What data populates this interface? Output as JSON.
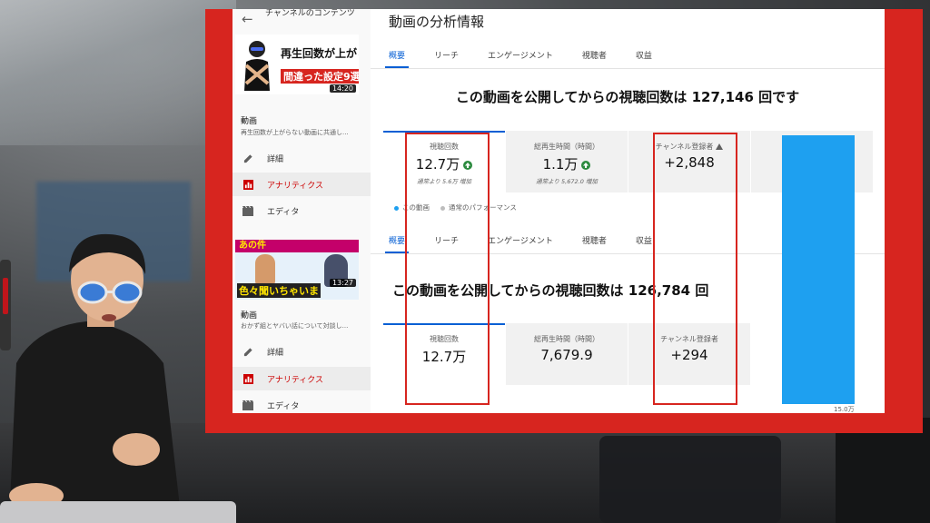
{
  "top": {
    "sidebar": {
      "channel_title": "チャンネルのコンテンツ",
      "thumb_line1": "再生回数が上がらない",
      "thumb_line2": "間違った設定9選",
      "duration": "14:20",
      "video_label": "動画",
      "video_desc": "再生回数が上がらない動画に共通し...",
      "items": [
        {
          "icon": "pencil-icon",
          "label": "詳細"
        },
        {
          "icon": "analytics-icon",
          "label": "アナリティクス"
        },
        {
          "icon": "film-icon",
          "label": "エディタ"
        }
      ]
    },
    "page_title": "動画の分析情報",
    "tabs": [
      "概要",
      "リーチ",
      "エンゲージメント",
      "視聴者",
      "収益"
    ],
    "headline": "この動画を公開してからの視聴回数は 127,146 回です",
    "cards": [
      {
        "label": "視聴回数",
        "value": "12.7万",
        "sub": "通常より 5.6万 増加",
        "trend": "up"
      },
      {
        "label": "総再生時間（時間）",
        "value": "1.1万",
        "sub": "通常より 5,672.0 増加",
        "trend": "up"
      },
      {
        "label": "チャンネル登録者",
        "value": "+2,848",
        "sub": "",
        "trend": "warn"
      }
    ],
    "legend": [
      "この動画",
      "通常のパフォーマンス"
    ]
  },
  "bottom": {
    "sidebar": {
      "thumb_banner": "あの件",
      "thumb_caption": "色々聞いちゃいま",
      "duration": "13:27",
      "video_label": "動画",
      "video_desc": "おかず組とヤバい話について対談し...",
      "items": [
        {
          "icon": "pencil-icon",
          "label": "詳細"
        },
        {
          "icon": "analytics-icon",
          "label": "アナリティクス"
        },
        {
          "icon": "film-icon",
          "label": "エディタ"
        }
      ]
    },
    "tabs": [
      "概要",
      "リーチ",
      "エンゲージメント",
      "視聴者",
      "収益"
    ],
    "headline": "この動画を公開してからの視聴回数は 126,784 回",
    "cards": [
      {
        "label": "視聴回数",
        "value": "12.7万"
      },
      {
        "label": "総再生時間（時間）",
        "value": "7,679.9"
      },
      {
        "label": "チャンネル登録者",
        "value": "+294"
      }
    ],
    "axis_label": "15.0万"
  },
  "colors": {
    "frame": "#d7251f",
    "accent_blue": "#065fd4",
    "bar": "#1ea0f0",
    "up_green": "#2b8a3e"
  }
}
